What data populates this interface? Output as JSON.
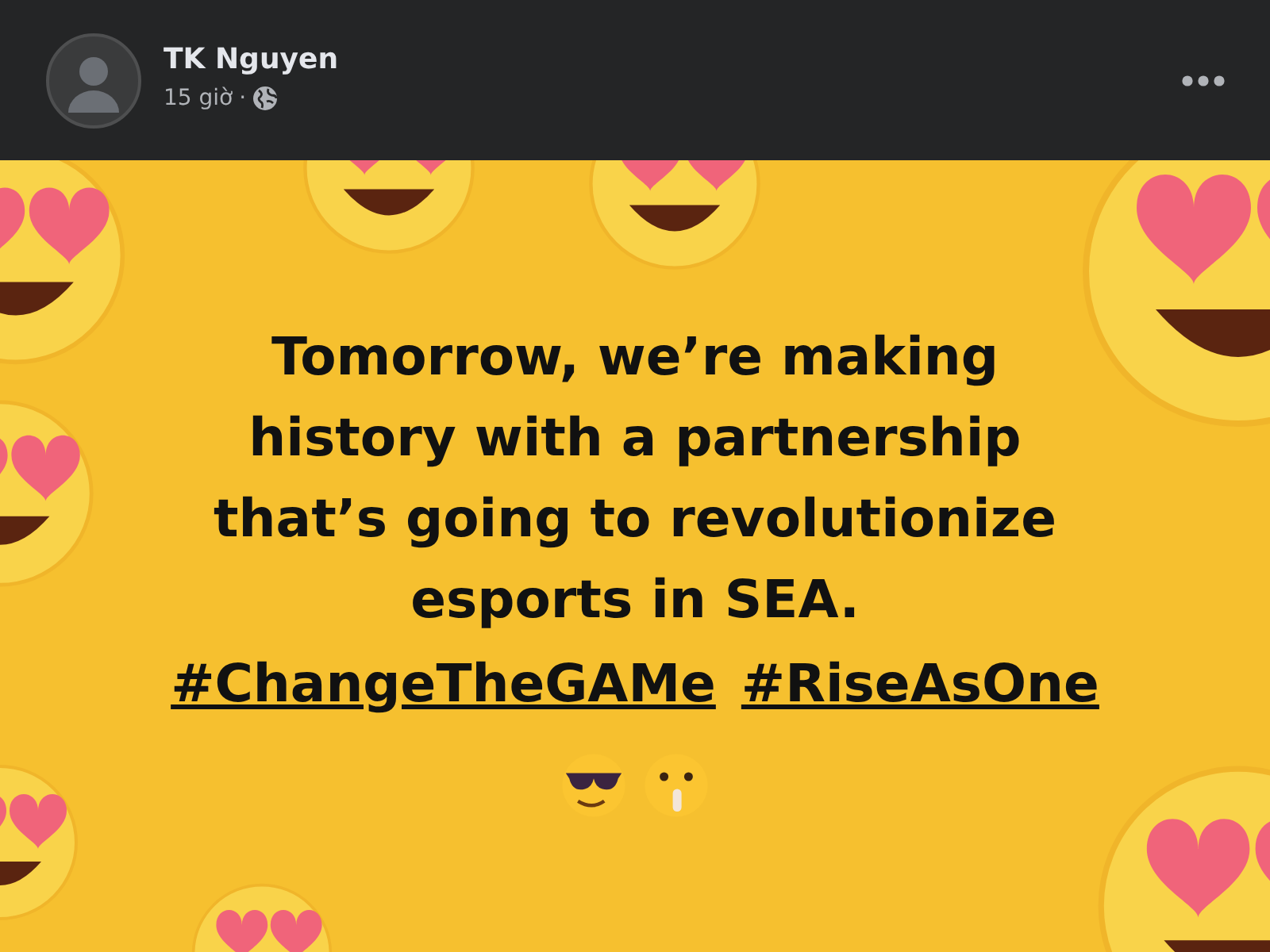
{
  "post": {
    "author": "TK Nguyen",
    "time": "15 giờ",
    "separator": "·",
    "public_audience": true,
    "message_lines": [
      "Tomorrow, we’re making",
      "history with a partnership",
      "that’s going to revolutionize",
      "esports in SEA."
    ],
    "hashtags": [
      "#ChangeTheGAMe",
      "#RiseAsOne"
    ]
  }
}
